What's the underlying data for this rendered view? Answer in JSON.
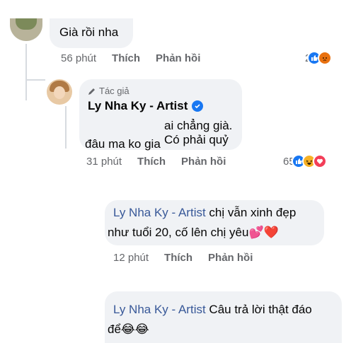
{
  "comment1": {
    "text": "Già rồi nha",
    "time": "56 phút",
    "like": "Thích",
    "reply": "Phản hồi",
    "reaction_count": "2",
    "reactions": [
      "like",
      "angry"
    ]
  },
  "comment2": {
    "badge": "Tác giả",
    "author": "Ly Nha Ky - Artist",
    "line1": "ai chẳng già. Có phải quỷ",
    "line2": "đâu ma ko gia",
    "time": "31 phút",
    "like": "Thích",
    "reply": "Phản hồi",
    "reaction_count": "65",
    "reactions": [
      "like",
      "haha",
      "love"
    ]
  },
  "comment3": {
    "mention": "Ly Nha Ky - Artist",
    "line1": "chị vẫn xinh đẹp",
    "line2": "như tuổi 20, cố lên chị yêu💕❤️",
    "time": "12 phút",
    "like": "Thích",
    "reply": "Phản hồi"
  },
  "comment4": {
    "mention": "Ly Nha Ky - Artist",
    "line1": "Câu trả lời thật đáo",
    "line2": "để😂😂"
  },
  "colors": {
    "bubble": "#f0f2f5",
    "link": "#385898",
    "meta": "#65676b",
    "like_blue": "#1877f2",
    "love_red": "#f33e58",
    "angry_orange": "#e9710f"
  }
}
